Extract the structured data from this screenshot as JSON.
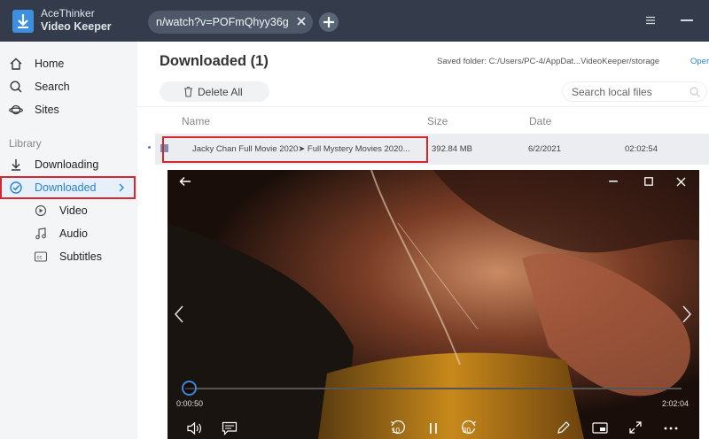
{
  "app": {
    "name_line1": "AceThinker",
    "name_line2": "Video Keeper"
  },
  "tab": {
    "url": "n/watch?v=POFmQhyy36g"
  },
  "sidebar": {
    "items": [
      {
        "label": "Home",
        "icon": "home-icon"
      },
      {
        "label": "Search",
        "icon": "search-icon"
      },
      {
        "label": "Sites",
        "icon": "planet-icon"
      }
    ],
    "section_label": "Library",
    "library": [
      {
        "label": "Downloading",
        "icon": "download-icon"
      },
      {
        "label": "Downloaded",
        "icon": "check-circle-icon",
        "active": true
      },
      {
        "label": "Video",
        "icon": "play-circle-icon"
      },
      {
        "label": "Audio",
        "icon": "music-note-icon"
      },
      {
        "label": "Subtitles",
        "icon": "cc-icon"
      }
    ]
  },
  "main": {
    "title": "Downloaded (1)",
    "saved_folder": "Saved folder: C:/Users/PC-4/AppDat...VideoKeeper/storage",
    "open_link": "Oper",
    "delete_all": "Delete All",
    "search_placeholder": "Search local files",
    "columns": {
      "name": "Name",
      "size": "Size",
      "date": "Date"
    },
    "rows": [
      {
        "name": "Jacky Chan Full Movie 2020➤ Full Mystery Movies 2020...",
        "size": "392.84 MB",
        "date": "6/2/2021",
        "duration": "02:02:54"
      }
    ]
  },
  "player": {
    "current_time": "0:00:50",
    "total_time": "2:02:04",
    "progress_fraction": 0.007,
    "skip_back": "10",
    "skip_forward": "30"
  },
  "colors": {
    "titlebar": "#343c4b",
    "accent": "#2a7fd4",
    "highlight": "#d32730"
  }
}
